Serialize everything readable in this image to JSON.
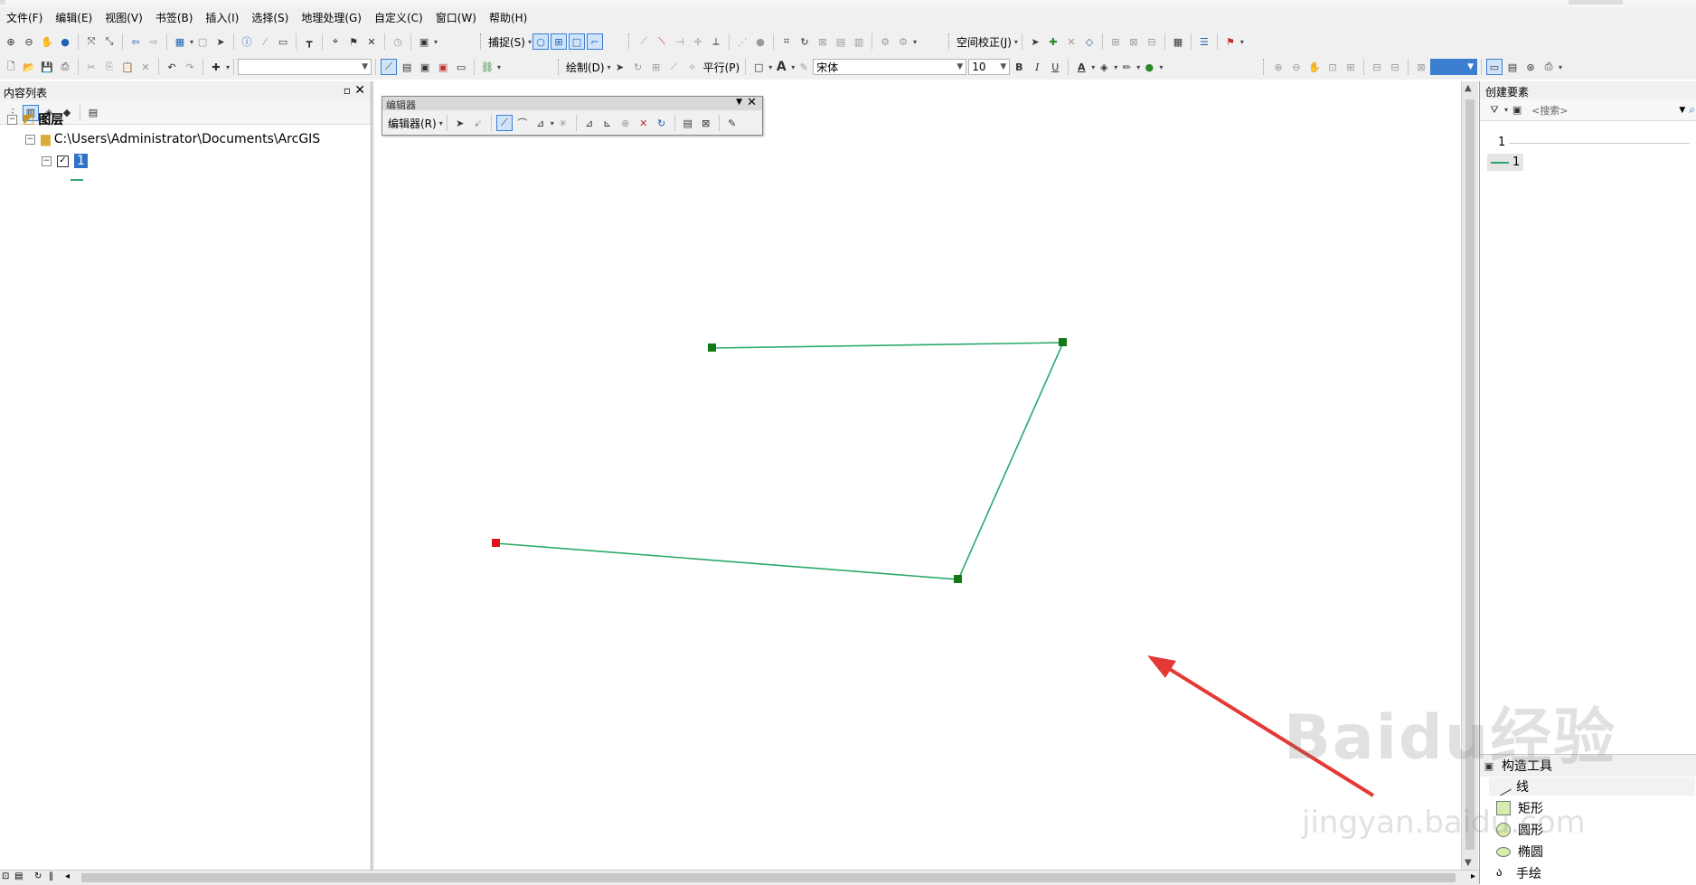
{
  "menu": [
    "文件(F)",
    "编辑(E)",
    "视图(V)",
    "书签(B)",
    "插入(I)",
    "选择(S)",
    "地理处理(G)",
    "自定义(C)",
    "窗口(W)",
    "帮助(H)"
  ],
  "toolbar1": {
    "snap_label": "捕捉(S)",
    "spatial_adjust_label": "空间校正(J)"
  },
  "toolbar2": {
    "draw_label": "绘制(D)",
    "parallel_label": "平行(P)",
    "font_name": "宋体",
    "font_size": "10",
    "bold": "B",
    "italic": "I",
    "underline": "U",
    "text_tool": "A"
  },
  "toc": {
    "title": "内容列表",
    "root_label": "图层",
    "folder_path": "C:\\Users\\Administrator\\Documents\\ArcGIS",
    "layer_name": "1"
  },
  "editor": {
    "title": "编辑器",
    "menu_label": "编辑器(R)"
  },
  "create_features": {
    "title": "创建要素",
    "search_placeholder": "<搜索>",
    "template_group": "1",
    "template_item": "1",
    "construction_tools_title": "构造工具",
    "tools": [
      "线",
      "矩形",
      "圆形",
      "椭圆",
      "手绘"
    ]
  },
  "watermark": {
    "text": "Baidu经验",
    "sub": "jingyan.baidu.com"
  },
  "colors": {
    "line": "#2aa86b",
    "vertex": "#127a12",
    "endpoint": "#e0141a",
    "arrow": "#e53935",
    "selection": "#3072c8"
  }
}
